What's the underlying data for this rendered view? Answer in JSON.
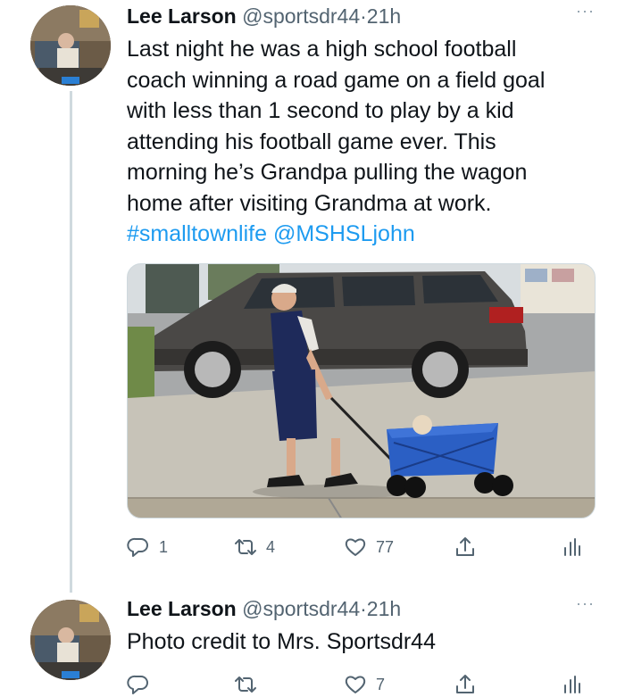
{
  "tweets": [
    {
      "author_name": "Lee Larson",
      "handle": "@sportsdr44",
      "dot": "·",
      "time": "21h",
      "more": "···",
      "text_lines": [
        "Last night he was a high school football",
        "coach winning a road game on a field goal",
        "with less than 1 second to play by a kid",
        "attending his football game ever. This",
        "morning he’s Grandpa pulling the wagon",
        "home after visiting Grandma at work."
      ],
      "hashtag": "#smalltownlife",
      "mention": "@MSHSLjohn",
      "counts": {
        "reply": "1",
        "retweet": "4",
        "like": "77"
      }
    },
    {
      "author_name": "Lee Larson",
      "handle": "@sportsdr44",
      "dot": "·",
      "time": "21h",
      "more": "···",
      "text_lines": [
        "Photo credit to Mrs. Sportsdr44"
      ],
      "counts": {
        "reply": "",
        "retweet": "",
        "like": "7"
      }
    }
  ],
  "colors": {
    "link": "#1d9bf0",
    "secondary": "#536471",
    "thread_line": "#cfd9de"
  },
  "icons": [
    "reply-icon",
    "retweet-icon",
    "like-icon",
    "share-icon",
    "analytics-icon",
    "more-icon"
  ]
}
